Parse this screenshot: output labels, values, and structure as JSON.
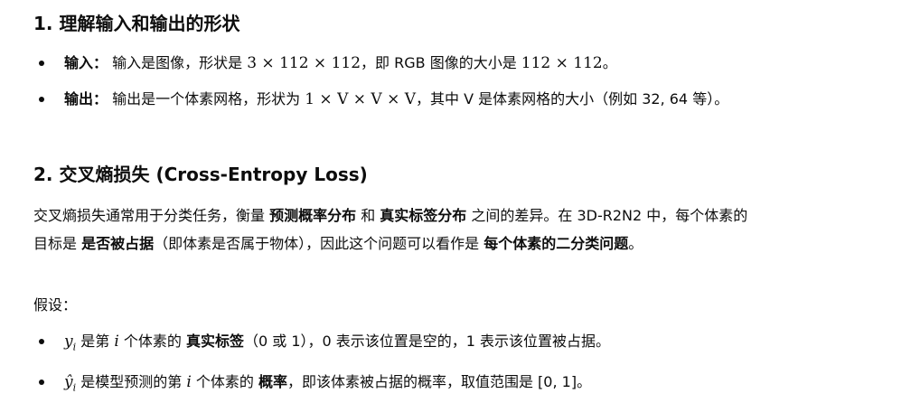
{
  "section1": {
    "heading": "1. 理解输入和输出的形状",
    "input": {
      "label": "输入：",
      "text1": "输入是图像，形状是 ",
      "math": "3 × 112 × 112",
      "text2": "，即 RGB 图像的大小是 ",
      "math2": "112 × 112",
      "text3": "。"
    },
    "output": {
      "label": "输出：",
      "text1": "输出是一个体素网格，形状为 ",
      "math": "1 × V × V × V",
      "text2": "，其中 V 是体素网格的大小（例如 32, 64 等）。"
    }
  },
  "section2": {
    "heading": "2. 交叉熵损失 (Cross-Entropy Loss)",
    "para": {
      "t1": "交叉熵损失通常用于分类任务，衡量 ",
      "b1": "预测概率分布",
      "t2": " 和 ",
      "b2": "真实标签分布",
      "t3": " 之间的差异。在 3D-R2N2 中，每个体素的目标是 ",
      "b3": "是否被占据",
      "t4": "（即体素是否属于物体），因此这个问题可以看作是 ",
      "b4": "每个体素的二分类问题",
      "t5": "。"
    },
    "assume": "假设：",
    "bullets": [
      {
        "math": "y",
        "sub": "i",
        "t1": " 是第 ",
        "math_i": "i",
        "t2": " 个体素的 ",
        "bold": "真实标签",
        "t3": "（0 或 1），0 表示该位置是空的，1 表示该位置被占据。"
      },
      {
        "math": "ŷ",
        "sub": "i",
        "t1": " 是模型预测的第 ",
        "math_i": "i",
        "t2": " 个体素的 ",
        "bold": "概率",
        "t3": "，即该体素被占据的概率，取值范围是 [0, 1]。"
      }
    ]
  }
}
